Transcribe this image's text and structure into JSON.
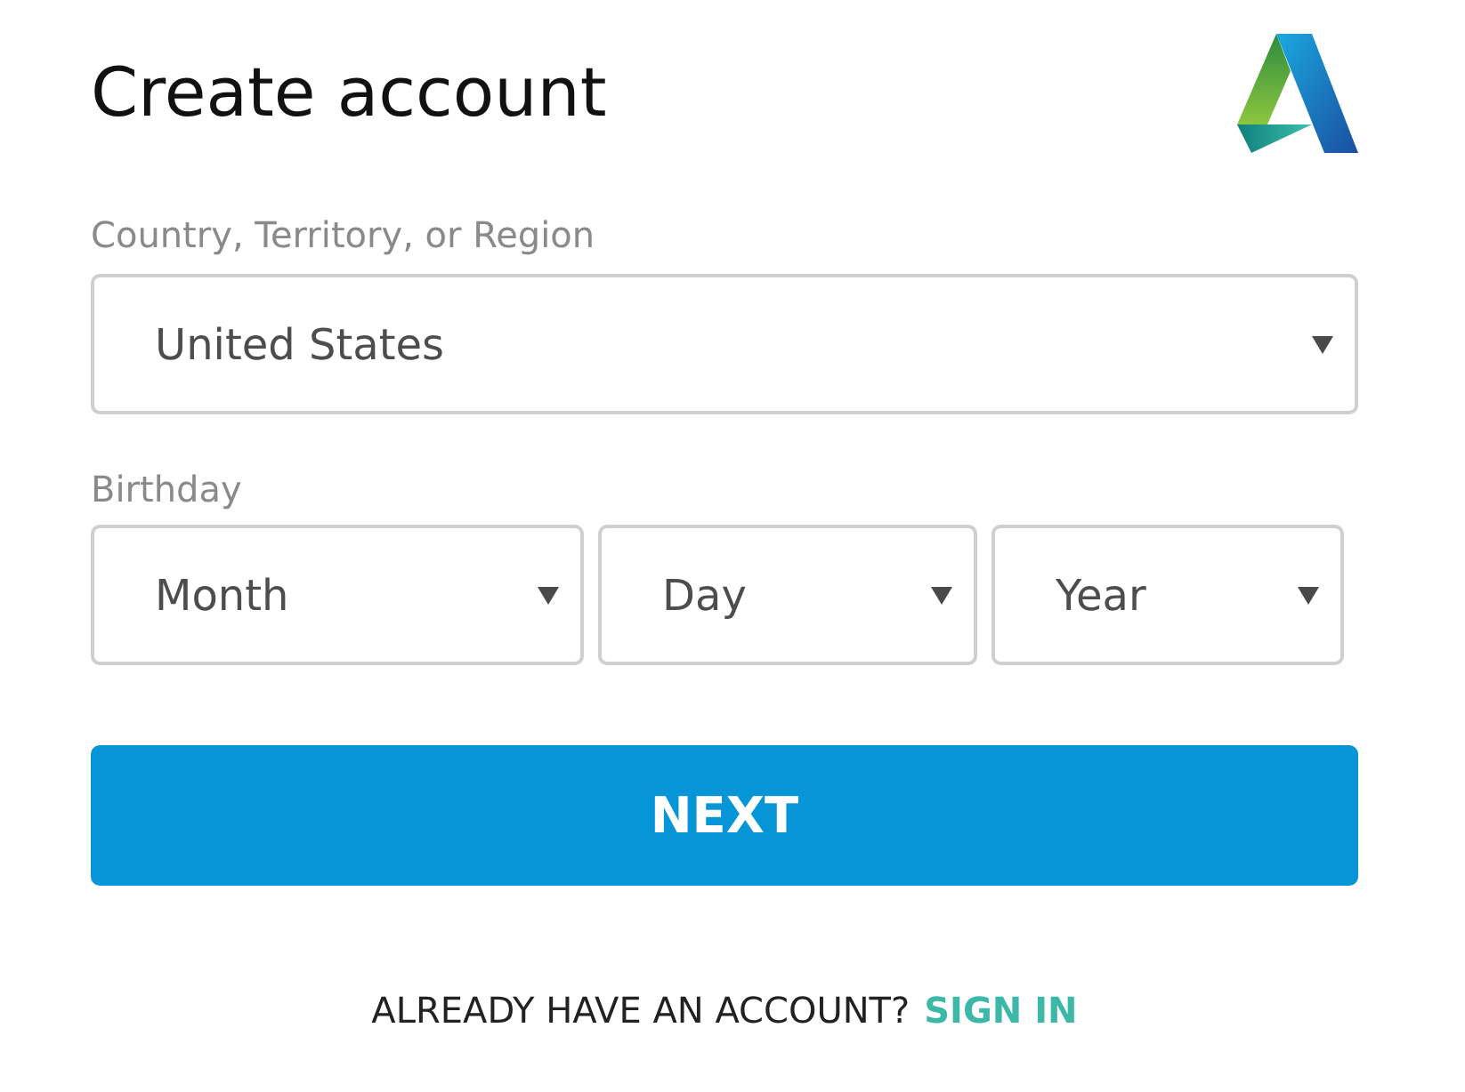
{
  "title": "Create account",
  "country": {
    "label": "Country, Territory, or Region",
    "value": "United States"
  },
  "birthday": {
    "label": "Birthday",
    "fields": [
      {
        "placeholder": "Month"
      },
      {
        "placeholder": "Day"
      },
      {
        "placeholder": "Year"
      }
    ]
  },
  "next_button": "NEXT",
  "footer": {
    "text": "ALREADY HAVE AN ACCOUNT?",
    "link": "SIGN IN"
  }
}
